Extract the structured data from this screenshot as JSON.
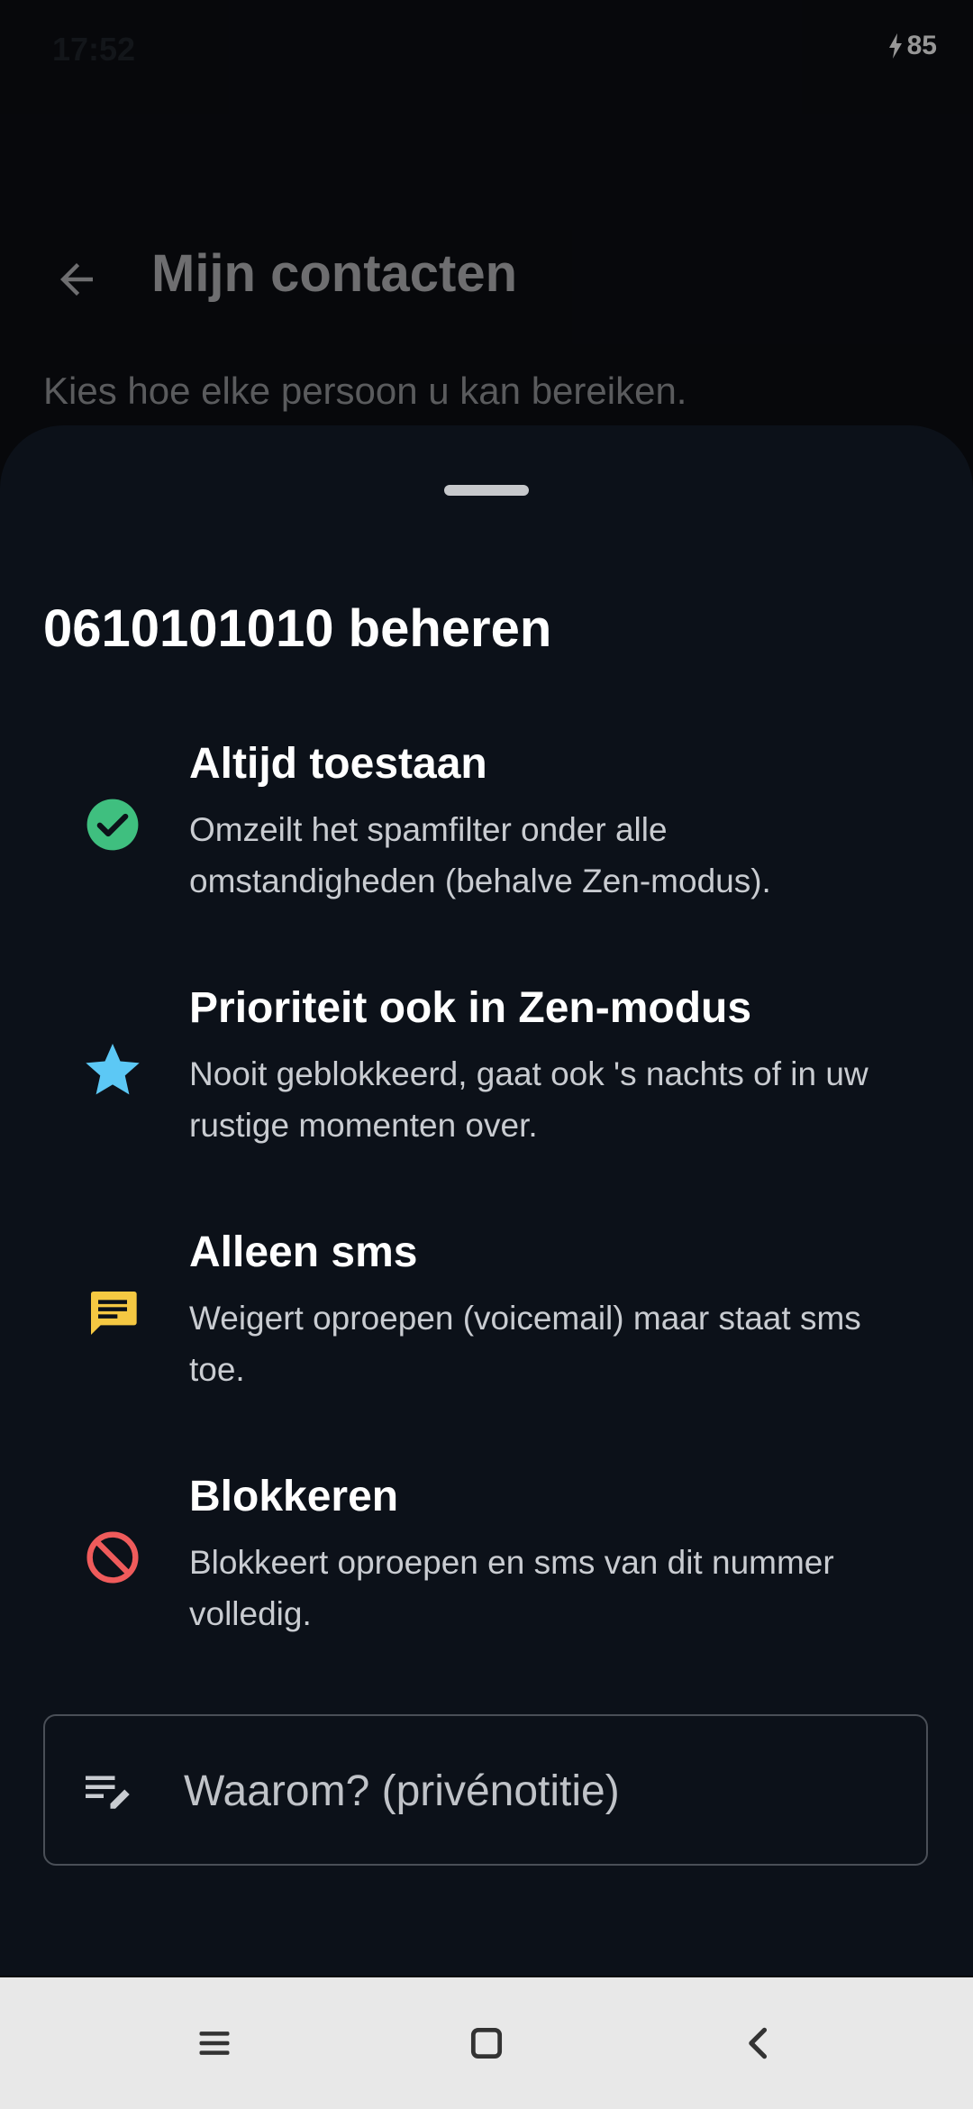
{
  "status_bar": {
    "time": "17:52",
    "battery": "85"
  },
  "header": {
    "title": "Mijn contacten",
    "subtitle": "Kies hoe elke persoon u kan bereiken."
  },
  "sheet": {
    "title": "0610101010 beheren",
    "options": [
      {
        "title": "Altijd toestaan",
        "description": "Omzeilt het spamfilter onder alle omstandigheden (behalve Zen-modus).",
        "icon": "check-circle-icon",
        "color": "#3fbf7f"
      },
      {
        "title": "Prioriteit ook in Zen-modus",
        "description": "Nooit geblokkeerd, gaat ook 's nachts of in uw rustige momenten over.",
        "icon": "star-icon",
        "color": "#5cc8f5"
      },
      {
        "title": "Alleen sms",
        "description": "Weigert oproepen (voicemail) maar staat sms toe.",
        "icon": "message-icon",
        "color": "#f5c842"
      },
      {
        "title": "Blokkeren",
        "description": "Blokkeert oproepen en sms van dit nummer volledig.",
        "icon": "block-icon",
        "color": "#ef5b5b"
      }
    ],
    "note": {
      "placeholder": "Waarom? (privénotitie)"
    }
  },
  "nav": {
    "menu": "menu-icon",
    "home": "home-icon",
    "back": "back-icon"
  }
}
